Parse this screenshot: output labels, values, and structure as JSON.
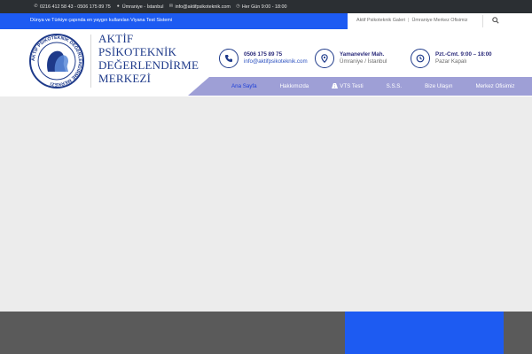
{
  "topbar": {
    "phone": "0216 412 58 43 - 0506 175 89 75",
    "location": "Ümraniye - İstanbul",
    "email": "info@aktifpsikoteknik.com",
    "hours": "Her Gün 9:00 - 18:00",
    "icons": {
      "phone": "phone-icon",
      "location": "map-pin-icon",
      "email": "envelope-icon",
      "hours": "clock-icon"
    }
  },
  "bluebar": {
    "tagline": "Dünya ve Türkiye çapında en yaygın kullanılan Viyana Test Sistemi",
    "links": [
      "Aktif Psikoteknik Galeri",
      "Ümraniye Merkez Ofisimiz"
    ],
    "link_separator": "|",
    "colors": {
      "blue": "#1d5bf2"
    }
  },
  "header": {
    "logo_text": [
      "AKTİF",
      "PSİKOTEKNİK",
      "DEĞERLENDİRME",
      "MERKEZİ"
    ],
    "logo_ring_text": "AKTİF PSİKOTEKNİK DEĞERLENDİRME MERKEZİ",
    "contacts": [
      {
        "icon": "phone-icon",
        "line1": "0506 175 89 75",
        "line2": "info@aktifpsikoteknik.com"
      },
      {
        "icon": "map-pin-icon",
        "line1": "Yamanevler Mah.",
        "line2": "Ümraniye / İstanbul"
      },
      {
        "icon": "clock-icon",
        "line1": "Pzt.-Cmt. 9:00 – 18:00",
        "line2": "Pazar Kapalı"
      }
    ]
  },
  "nav": {
    "items": [
      "Ana Sayfa",
      "Hakkımızda",
      "VTS Testi",
      "S.S.S.",
      "Bize Ulaşın",
      "Merkez Ofisimiz"
    ],
    "active_index": 0,
    "colors": {
      "bg": "#9e9fd6",
      "active": "#1d3fd8"
    }
  }
}
